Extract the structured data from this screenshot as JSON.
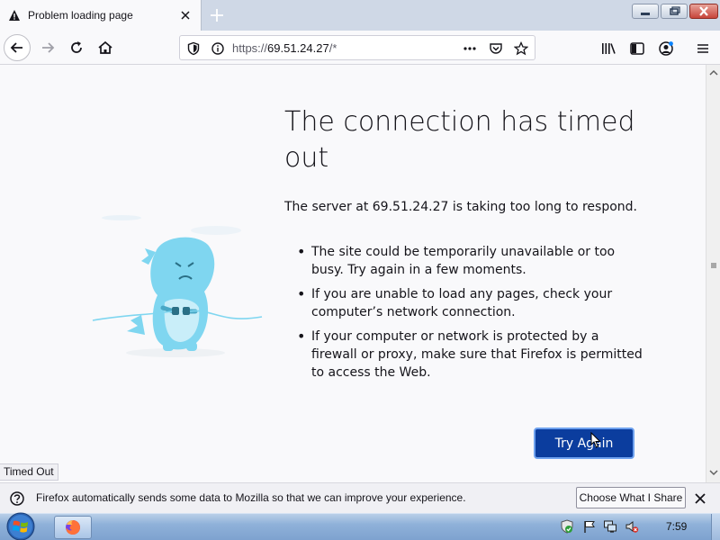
{
  "tab": {
    "title": "Problem loading page"
  },
  "urlbar": {
    "scheme": "https://",
    "host": "69.51.24.27",
    "path": "/*"
  },
  "error": {
    "title": "The connection has timed out",
    "description": "The server at 69.51.24.27 is taking too long to respond.",
    "reasons": [
      "The site could be temporarily unavailable or too busy. Try again in a few moments.",
      "If you are unable to load any pages, check your computer’s network connection.",
      "If your computer or network is protected by a firewall or proxy, make sure that Firefox is permitted to access the Web."
    ],
    "button_label": "Try Again"
  },
  "status": {
    "text": "Timed Out"
  },
  "notification": {
    "text": "Firefox automatically sends some data to Mozilla so that we can improve your experience.",
    "button_label": "Choose What I Share"
  },
  "taskbar": {
    "clock": "7:59"
  },
  "colors": {
    "accent": "#0b3d9e",
    "tab_bar": "#cfd8e6",
    "dino": "#7fd6f0"
  },
  "icons": [
    "warning-icon",
    "close-icon",
    "plus-icon",
    "back-arrow-icon",
    "forward-arrow-icon",
    "reload-icon",
    "home-icon",
    "shield-icon",
    "info-icon",
    "more-dots-icon",
    "pocket-icon",
    "star-icon",
    "library-icon",
    "sidebar-icon",
    "account-icon",
    "hamburger-menu-icon",
    "question-icon",
    "windows-start-icon",
    "firefox-icon"
  ]
}
